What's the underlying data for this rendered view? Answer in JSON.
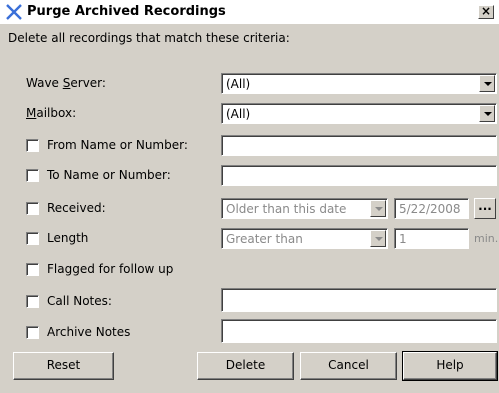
{
  "window": {
    "title": "Purge Archived Recordings",
    "close_glyph": "×"
  },
  "intro_text": "Delete all recordings that match these criteria:",
  "fields": {
    "wave_server": {
      "label_pre": "Wave ",
      "label_acc": "S",
      "label_post": "erver:",
      "value": "(All)"
    },
    "mailbox": {
      "label_pre": "",
      "label_acc": "M",
      "label_post": "ailbox:",
      "value": "(All)"
    },
    "from": {
      "label": "From Name or Number:",
      "checked": false,
      "value": ""
    },
    "to": {
      "label": "To Name or Number:",
      "checked": false,
      "value": ""
    },
    "received": {
      "label": "Received:",
      "checked": false,
      "condition": "Older than this date",
      "date": "5/22/2008",
      "browse_label": "..."
    },
    "length": {
      "label": "Length",
      "checked": false,
      "condition": "Greater than",
      "value": "1",
      "unit": "min."
    },
    "flagged": {
      "label": "Flagged for follow up",
      "checked": false
    },
    "call_notes": {
      "label": "Call Notes:",
      "checked": false,
      "value": ""
    },
    "archive_notes": {
      "label": "Archive Notes",
      "checked": false,
      "value": ""
    }
  },
  "buttons": {
    "reset": "Reset",
    "delete": "Delete",
    "cancel": "Cancel",
    "help": "Help"
  },
  "icons": {
    "app": "x-icon",
    "close": "close-icon",
    "dropdown": "chevron-down-icon"
  },
  "colors": {
    "dialog_bg": "#d4d0c8",
    "title_bg": "#ffffff",
    "app_icon": "#3a6fd8",
    "disabled_text": "#8a8a8a"
  }
}
